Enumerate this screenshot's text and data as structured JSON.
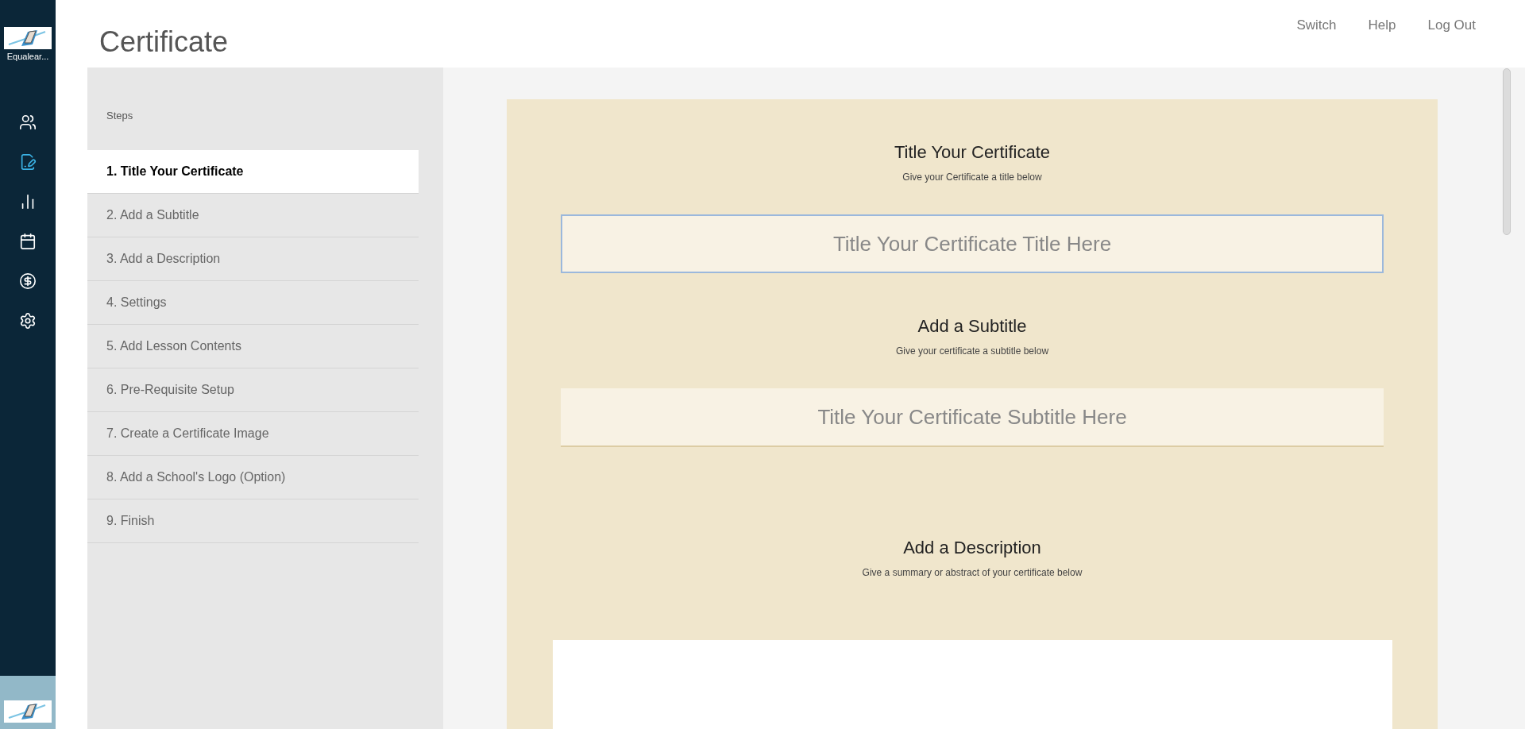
{
  "sidebar": {
    "brand": "Equalear...",
    "items": [
      {
        "selected": false
      },
      {
        "selected": true
      },
      {
        "selected": false
      },
      {
        "selected": false
      },
      {
        "selected": false
      },
      {
        "selected": false
      }
    ]
  },
  "header": {
    "title": "Certificate",
    "links": [
      "Switch",
      "Help",
      "Log Out"
    ]
  },
  "steps": {
    "heading": "Steps",
    "items": [
      {
        "label": "1. Title Your Certificate",
        "selected": true
      },
      {
        "label": "2. Add a Subtitle",
        "selected": false
      },
      {
        "label": "3. Add a Description",
        "selected": false
      },
      {
        "label": "4. Settings",
        "selected": false
      },
      {
        "label": "5. Add Lesson Contents",
        "selected": false
      },
      {
        "label": "6. Pre-Requisite Setup",
        "selected": false
      },
      {
        "label": "7. Create a Certificate Image",
        "selected": false
      },
      {
        "label": "8. Add a School's Logo (Option)",
        "selected": false
      },
      {
        "label": "9. Finish",
        "selected": false
      }
    ]
  },
  "sections": [
    {
      "kind": "input",
      "heading": "Title Your Certificate",
      "hint": "Give your Certificate a title below",
      "placeholder": "Title Your Certificate Title Here",
      "focused": true
    },
    {
      "kind": "input",
      "heading": "Add a Subtitle",
      "hint": "Give your certificate a subtitle below",
      "placeholder": "Title Your Certificate Subtitle Here",
      "focused": false
    },
    {
      "kind": "editor",
      "heading": "Add a Description",
      "hint": "Give a summary or abstract of your certificate below"
    }
  ]
}
